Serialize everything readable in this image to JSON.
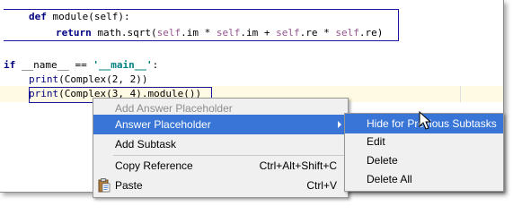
{
  "editor": {
    "line1_kw": "def",
    "line1_rest": " module(self):",
    "line2_kw": "return",
    "line2_rest": " math.sqrt(",
    "line2_self1": "self",
    "line2_a": ".im * ",
    "line2_self2": "self",
    "line2_b": ".im + ",
    "line2_self3": "self",
    "line2_c": ".re * ",
    "line2_self4": "self",
    "line2_d": ".re)",
    "line4_kw": "if",
    "line4_a": " __name__ == ",
    "line4_str": "'__main__'",
    "line4_b": ":",
    "line5_kw": "print",
    "line5_rest": "(Complex(2, 2))",
    "line6_kw": "print",
    "line6_rest": "(Complex(3, 4).module())"
  },
  "context_menu": {
    "items": [
      {
        "label": "Add Answer Placeholder",
        "disabled": true
      },
      {
        "label": "Answer Placeholder",
        "selected": true
      },
      {
        "label": "Add Subtask"
      },
      {
        "label": "Copy Reference",
        "shortcut": "Ctrl+Alt+Shift+C"
      },
      {
        "label": "Paste",
        "shortcut": "Ctrl+V"
      }
    ]
  },
  "submenu": {
    "items": [
      {
        "label": "Hide for Previous Subtasks",
        "selected": true
      },
      {
        "label": "Edit"
      },
      {
        "label": "Delete"
      },
      {
        "label": "Delete All"
      }
    ]
  },
  "colors": {
    "selection": "#3875d7",
    "placeholder_border": "#1a1aa0",
    "keyword": "#000080",
    "self": "#94558d",
    "string": "#008080",
    "current_line": "#fffae3"
  },
  "icons": [
    "paste-icon",
    "submenu-arrow-icon",
    "mouse-cursor-icon"
  ]
}
